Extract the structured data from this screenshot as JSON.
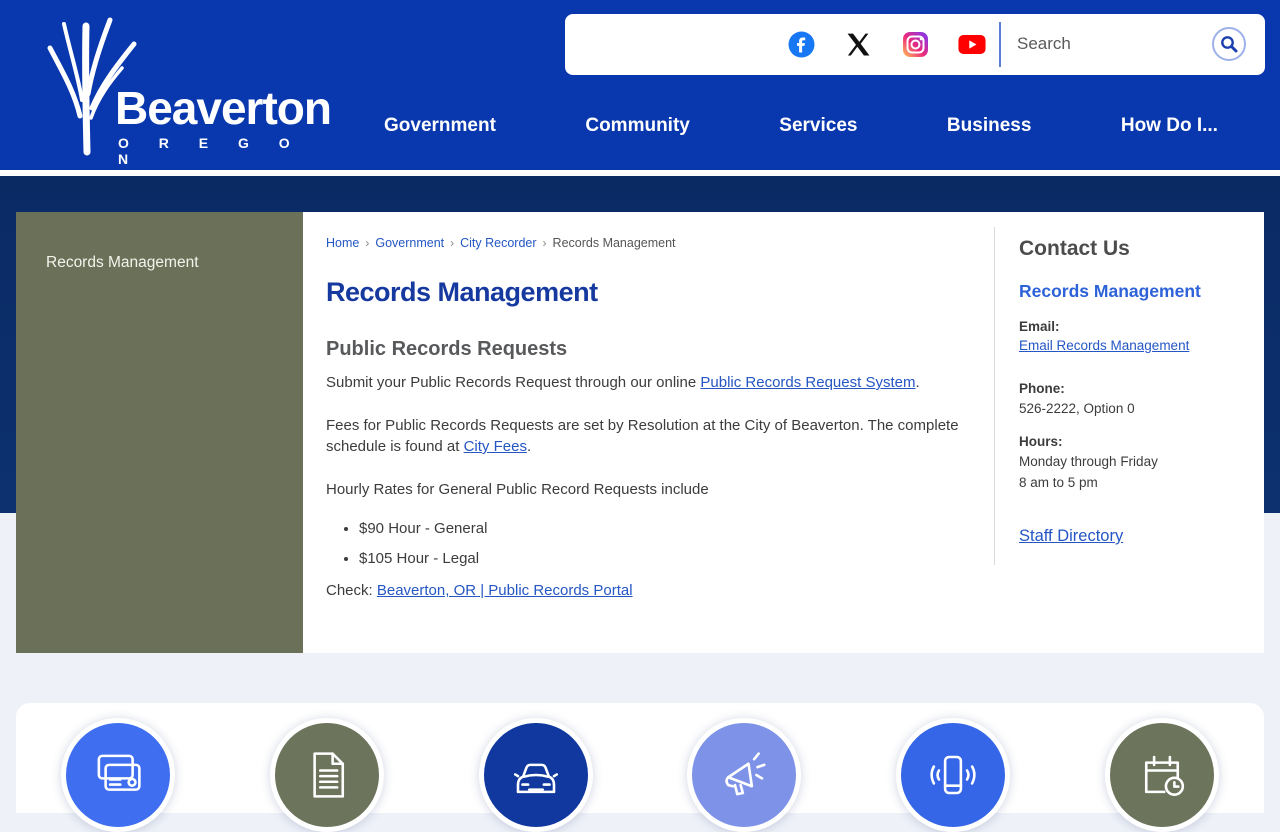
{
  "brand": {
    "name": "Beaverton",
    "state": "O R E G O N"
  },
  "header": {
    "nav": [
      {
        "label": "Government"
      },
      {
        "label": "Community"
      },
      {
        "label": "Services"
      },
      {
        "label": "Business"
      },
      {
        "label": "How Do I..."
      }
    ],
    "search": {
      "placeholder": "Search"
    },
    "social": [
      {
        "icon": "facebook-icon"
      },
      {
        "icon": "x-icon"
      },
      {
        "icon": "instagram-icon"
      },
      {
        "icon": "youtube-icon"
      }
    ]
  },
  "sidebar": {
    "items": [
      {
        "label": "Records Management"
      }
    ]
  },
  "breadcrumb": [
    {
      "label": "Home"
    },
    {
      "label": "Government"
    },
    {
      "label": "City Recorder"
    },
    {
      "label": "Records Management"
    }
  ],
  "breadcrumb_separator": "›",
  "main": {
    "title": "Records Management",
    "section_heading": "Public Records Requests",
    "p1_before": "Submit your Public Records Request through our online ",
    "p1_link": "Public Records Request System",
    "p1_after": ".",
    "p2_before": "Fees for Public Records Requests are set by Resolution at the City of Beaverton. The complete schedule is found at ",
    "p2_link": "City Fees",
    "p2_after": ".",
    "p3": "Hourly Rates for General Public Record Requests include",
    "bullets": [
      "$90 Hour - General",
      "$105 Hour - Legal"
    ],
    "p4_before": "Check: ",
    "p4_link": "Beaverton, OR | Public Records Portal"
  },
  "contact": {
    "heading": "Contact Us",
    "department": "Records Management",
    "email_label": "Email:",
    "email_link": "Email Records Management",
    "phone_label": "Phone:",
    "phone_value": "526-2222, Option 0",
    "hours_label": "Hours:",
    "hours_line1": "Monday through Friday",
    "hours_line2": "8 am to 5 pm",
    "staff_directory": "Staff Directory"
  },
  "quicklinks": [
    {
      "icon": "payments-icon",
      "color": "#3f6ff0"
    },
    {
      "icon": "documents-icon",
      "color": "#6d745c"
    },
    {
      "icon": "vehicle-icon",
      "color": "#10389f"
    },
    {
      "icon": "announcements-icon",
      "color": "#7e93e8"
    },
    {
      "icon": "mobile-alerts-icon",
      "color": "#3566e8"
    },
    {
      "icon": "calendar-icon",
      "color": "#6d745c"
    }
  ],
  "colors": {
    "header_blue": "#0938ae",
    "band_navy": "#0c2e6b",
    "sidebar_olive": "#6b7159",
    "heading_blue": "#16399f",
    "link_blue": "#2456c4",
    "page_background": "#eef1f8",
    "facebook_blue": "#1877f2",
    "youtube_red": "#ff0000"
  }
}
